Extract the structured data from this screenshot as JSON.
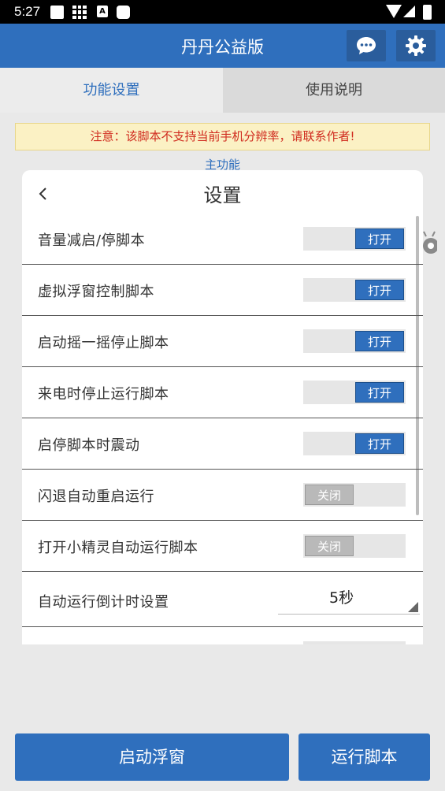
{
  "status_bar": {
    "time": "5:27"
  },
  "header": {
    "title": "丹丹公益版",
    "chat_icon": "chat-bubble-icon",
    "settings_icon": "gear-icon",
    "color": "#2f6fbd"
  },
  "tabs": [
    {
      "label": "功能设置",
      "active": true
    },
    {
      "label": "使用说明",
      "active": false
    }
  ],
  "notice": "注意：该脚本不支持当前手机分辨率，请联系作者!",
  "section_label": "主功能",
  "dialog": {
    "title": "设置",
    "rows": [
      {
        "label": "音量减启/停脚本",
        "type": "toggle",
        "state": "打开",
        "on": true
      },
      {
        "label": "虚拟浮窗控制脚本",
        "type": "toggle",
        "state": "打开",
        "on": true
      },
      {
        "label": "启动摇一摇停止脚本",
        "type": "toggle",
        "state": "打开",
        "on": true
      },
      {
        "label": "来电时停止运行脚本",
        "type": "toggle",
        "state": "打开",
        "on": true
      },
      {
        "label": "启停脚本时震动",
        "type": "toggle",
        "state": "打开",
        "on": true
      },
      {
        "label": "闪退自动重启运行",
        "type": "toggle",
        "state": "关闭",
        "on": false
      },
      {
        "label": "打开小精灵自动运行脚本",
        "type": "toggle",
        "state": "关闭",
        "on": false
      },
      {
        "label": "自动运行倒计时设置",
        "type": "select",
        "value": "5秒"
      }
    ]
  },
  "buttons": {
    "start_float": "启动浮窗",
    "run_script": "运行脚本"
  }
}
